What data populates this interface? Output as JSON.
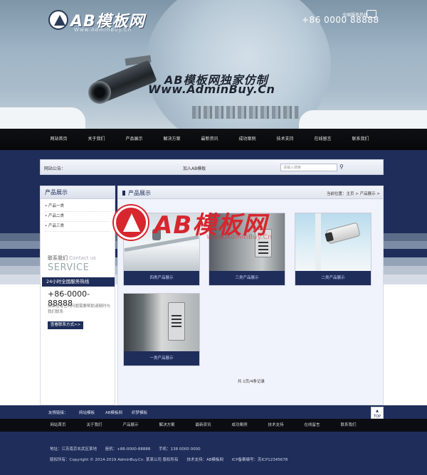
{
  "header": {
    "logo_text": "AB模板网",
    "logo_sub": "Www.AdminBuy.Cn",
    "hotline_label": "全国服务热线",
    "hotline": "+86 0000 88888",
    "slogan_cn": "AB模板网独家仿制",
    "slogan_url": "Www.AdminBuy.Cn"
  },
  "nav": [
    "网站首页",
    "关于我们",
    "产品展示",
    "解决方案",
    "最新资讯",
    "成功案例",
    "技术支持",
    "在线留言",
    "联系我们"
  ],
  "notice": {
    "label": "网站公告：",
    "message": "加入AB模板",
    "search_placeholder": "请输入搜索"
  },
  "sidebar": {
    "title": "产品展示",
    "items": [
      "产品一类",
      "产品二类",
      "产品三类"
    ],
    "contact_cn": "联系我们",
    "contact_en": "Contact us",
    "service": "SERVICE",
    "hotline_bar": "24小时全国服务热线",
    "phone": "+86-0000-88888",
    "desc": "如果您有任何问题需要帮助请随时与我们联系",
    "button": "查看联系方式>>"
  },
  "main": {
    "title": "产品展示",
    "breadcrumb": "当前位置：主页 > 产品展示 >",
    "products": [
      "四类产品展示",
      "三类产品展示",
      "二类产品展示",
      "一类产品展示"
    ],
    "pager": "共 1页/4条记录"
  },
  "watermark": {
    "text": "AB模板网",
    "url": "Www.AdminBuy.Cn"
  },
  "links": {
    "label": "友情链接：",
    "items": [
      "网站模板",
      "AB模板网",
      "织梦模板"
    ],
    "top": "TOP"
  },
  "footer_nav": [
    "网站首页",
    "关于我们",
    "产品展示",
    "解决方案",
    "最新资讯",
    "成功案例",
    "技术支持",
    "在线留言",
    "联系我们"
  ],
  "footer": {
    "address": "地址：江苏南京玄武区某地",
    "phone": "座机：+86-0000-88888",
    "mobile": "手机：138 0000 0000",
    "copyright": "版权所有：Copyright © 2014-2019 AdminBuy.Cn. 某某公司 版权所有",
    "support": "技术支持：AB模板网",
    "icp": "ICP备案编号：苏ICP12345678"
  }
}
